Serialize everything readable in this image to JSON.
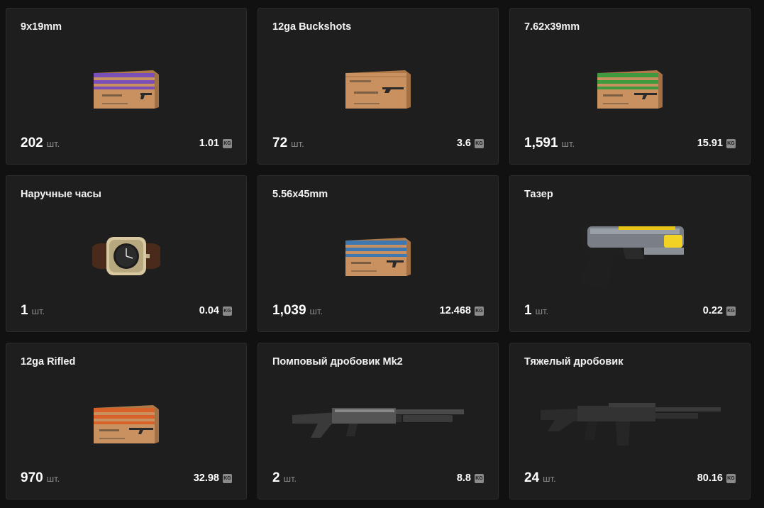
{
  "weight_unit": "KG",
  "items": [
    {
      "name": "9x19mm",
      "count": "202",
      "unit": "шт.",
      "weight": "1.01",
      "icon": "ammo-box-9x19-icon",
      "color": "#7b4fb8",
      "gun": "pistol"
    },
    {
      "name": "12ga Buckshots",
      "count": "72",
      "unit": "шт.",
      "weight": "3.6",
      "icon": "ammo-box-buckshot-icon",
      "color": "#c9915f",
      "gun": "shotgun"
    },
    {
      "name": "7.62x39mm",
      "count": "1,591",
      "unit": "шт.",
      "weight": "15.91",
      "icon": "ammo-box-762-icon",
      "color": "#3f9a3f",
      "gun": "rifle"
    },
    {
      "name": "Наручные часы",
      "count": "1",
      "unit": "шт.",
      "weight": "0.04",
      "icon": "wristwatch-icon"
    },
    {
      "name": "5.56x45mm",
      "count": "1,039",
      "unit": "шт.",
      "weight": "12.468",
      "icon": "ammo-box-556-icon",
      "color": "#3f77b0",
      "gun": "smg"
    },
    {
      "name": "Тазер",
      "count": "1",
      "unit": "шт.",
      "weight": "0.22",
      "icon": "taser-icon"
    },
    {
      "name": "12ga Rifled",
      "count": "970",
      "unit": "шт.",
      "weight": "32.98",
      "icon": "ammo-box-rifled-icon",
      "color": "#d8622a",
      "gun": "rifle"
    },
    {
      "name": "Помповый дробовик Mk2",
      "count": "2",
      "unit": "шт.",
      "weight": "8.8",
      "icon": "pump-shotgun-icon"
    },
    {
      "name": "Тяжелый дробовик",
      "count": "24",
      "unit": "шт.",
      "weight": "80.16",
      "icon": "heavy-shotgun-icon"
    }
  ]
}
